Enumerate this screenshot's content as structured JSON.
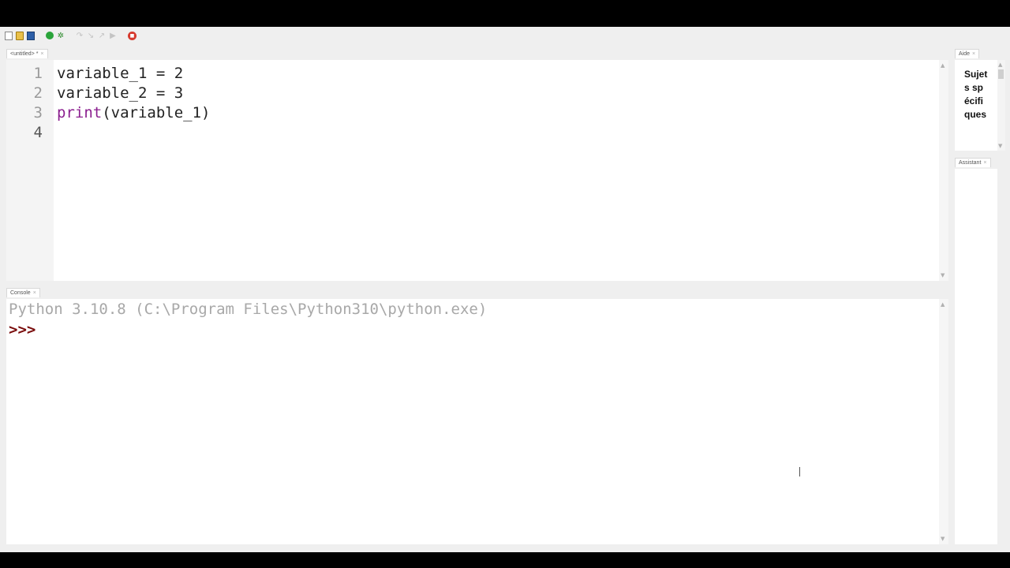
{
  "toolbar": {
    "icons": [
      "new-file-icon",
      "open-folder-icon",
      "save-icon",
      "run-icon",
      "debug-icon",
      "step-icon",
      "step-over-icon",
      "step-out-icon",
      "continue-icon",
      "stop-icon"
    ]
  },
  "editor": {
    "tab_label": "<untitled> *",
    "lines": [
      {
        "n": "1",
        "pre": "variable_1 = 2",
        "kw": "",
        "post": ""
      },
      {
        "n": "2",
        "pre": "variable_2 = 3",
        "kw": "",
        "post": ""
      },
      {
        "n": "3",
        "pre": "",
        "kw": "print",
        "post": "(variable_1)"
      },
      {
        "n": "4",
        "pre": "",
        "kw": "",
        "post": ""
      }
    ]
  },
  "console": {
    "tab_label": "Console",
    "banner": "Python 3.10.8 (C:\\Program Files\\Python310\\python.exe)",
    "prompt": ">>>"
  },
  "aide": {
    "tab_label": "Aide",
    "text": "Sujets spécifiques"
  },
  "assistant": {
    "tab_label": "Assistant"
  },
  "colors": {
    "keyword": "#8b1f8f",
    "prompt": "#7a0d0d",
    "banner": "#a8a8a8"
  }
}
